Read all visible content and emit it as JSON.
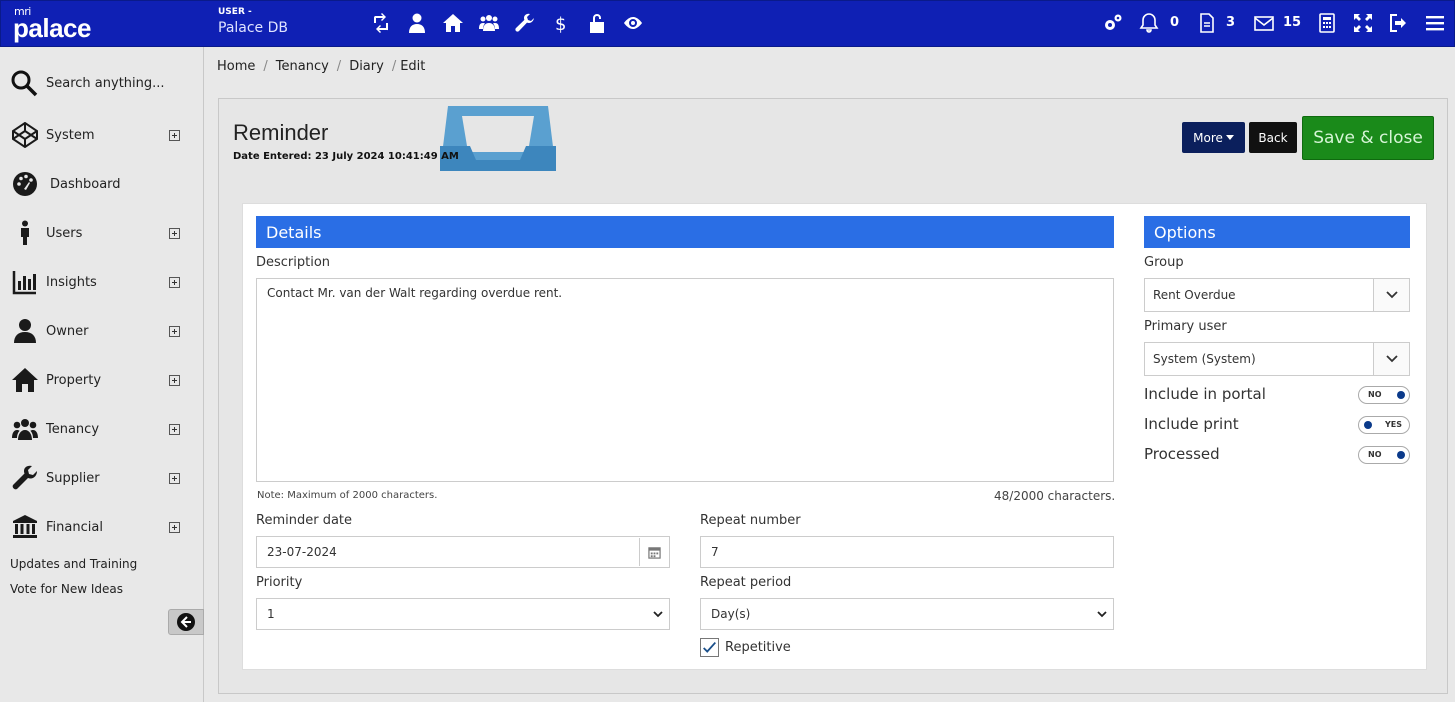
{
  "header": {
    "logo_mri": "mri",
    "logo_palace": "palace",
    "user_label": "USER -",
    "db_name": "Palace DB",
    "notifications_count": "0",
    "documents_count": "3",
    "messages_count": "15"
  },
  "sidebar": {
    "search_placeholder": "Search anything...",
    "items": [
      {
        "label": "System",
        "icon": "codepen-icon"
      },
      {
        "label": "Dashboard",
        "icon": "dashboard-icon"
      },
      {
        "label": "Users",
        "icon": "person-icon"
      },
      {
        "label": "Insights",
        "icon": "bar-chart-icon"
      },
      {
        "label": "Owner",
        "icon": "user-icon"
      },
      {
        "label": "Property",
        "icon": "home-icon"
      },
      {
        "label": "Tenancy",
        "icon": "group-icon"
      },
      {
        "label": "Supplier",
        "icon": "wrench-icon"
      },
      {
        "label": "Financial",
        "icon": "bank-icon"
      }
    ],
    "links": [
      "Updates and Training",
      "Vote for New Ideas"
    ]
  },
  "breadcrumb": [
    "Home",
    "Tenancy",
    "Diary",
    "Edit"
  ],
  "page": {
    "title": "Reminder",
    "date_entered": "Date Entered: 23 July 2024 10:41:49 AM",
    "more_label": "More",
    "back_label": "Back",
    "save_label": "Save & close"
  },
  "details": {
    "header": "Details",
    "description_label": "Description",
    "description_value": "Contact Mr. van der Walt regarding overdue rent.",
    "note": "Note: Maximum of 2000 characters.",
    "char_count": "48/2000 characters.",
    "reminder_date_label": "Reminder date",
    "reminder_date_value": "23-07-2024",
    "priority_label": "Priority",
    "priority_value": "1",
    "repeat_number_label": "Repeat number",
    "repeat_number_value": "7",
    "repeat_period_label": "Repeat period",
    "repeat_period_value": "Day(s)",
    "repetitive_label": "Repetitive",
    "repetitive_checked": true
  },
  "options": {
    "header": "Options",
    "group_label": "Group",
    "group_value": "Rent Overdue",
    "primary_user_label": "Primary user",
    "primary_user_value": "System (System)",
    "toggles": [
      {
        "label": "Include in portal",
        "state": "NO"
      },
      {
        "label": "Include print",
        "state": "YES"
      },
      {
        "label": "Processed",
        "state": "NO"
      }
    ]
  },
  "colors": {
    "topbar": "#0f20b4",
    "section_header": "#2a6ee5",
    "save_button": "#1a8a1a",
    "more_button": "#0b1f5c"
  }
}
